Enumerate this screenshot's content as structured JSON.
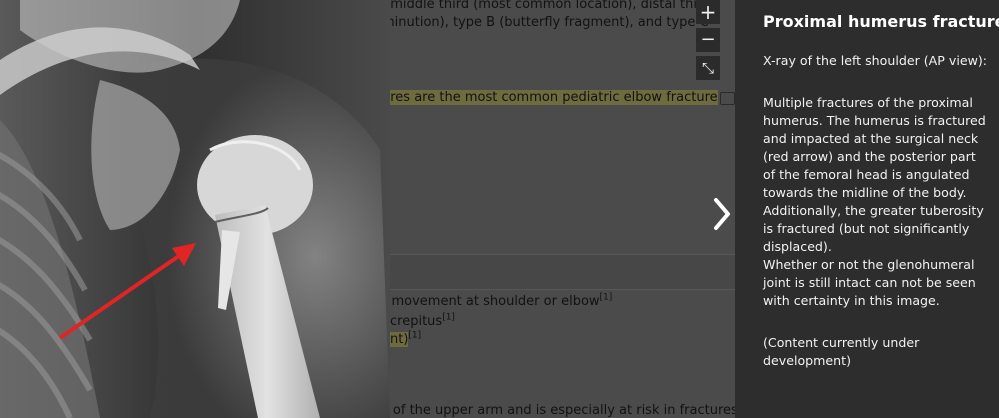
{
  "document": {
    "line1": ", middle third (most common location), distal thi",
    "line2": "minution), type B (butterfly fragment), and type C",
    "line3": "ures are the most common pediatric elbow fracture",
    "line4_text": "r movement at shoulder or elbow",
    "line4_ref": "[1]",
    "line5_text": "crepitus",
    "line5_ref": "[1]",
    "line6_text": "ent)",
    "line6_ref": "[1]",
    "line7": "s of the upper arm and is especially at risk in fractures"
  },
  "viewer": {
    "zoom_in": "+",
    "zoom_out": "−",
    "collapse": "⤡"
  },
  "caption": {
    "title": "Proximal humerus fracture",
    "subtitle": "X-ray of the left shoulder (AP view):",
    "paragraph": "Multiple fractures of the proximal humerus. The humerus is fractured and impacted at the surgical neck (red arrow) and the posterior part of the femoral head is angulated towards the midline of the body. Additionally, the greater tuberosity is fractured (but not significantly displaced).",
    "paragraph2": "Whether or not the glenohumeral joint is still intact can not be seen with certainty in this image.",
    "note": "(Content currently under development)"
  },
  "colors": {
    "arrow": "#e02525",
    "panel": "#2d2d2d"
  }
}
